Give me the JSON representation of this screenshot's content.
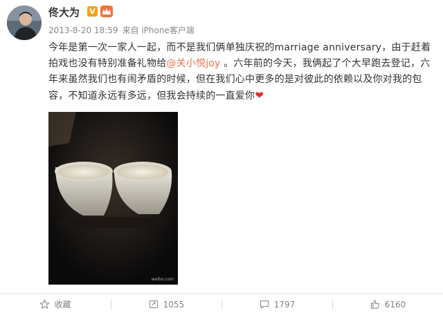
{
  "post": {
    "username": "佟大为",
    "verified_badge": "V",
    "timestamp": "2013-8-20 18:59",
    "source": "来自 iPhone客户端",
    "text_part1": "今年是第一次一家人一起，而不是我们俩单独庆祝的marriage anniversary，由于赶着拍戏也没有特别准备礼物给",
    "mention": "@关小悦joy",
    "text_part2": " 。六年前的今天，我俩起了个大早跑去登记，六年来虽然我们也有闹矛盾的时候，但在我们心中更多的是对彼此的依赖以及你对我的包容，不知道永远有多远，但我会持续的一直爱你",
    "emoji": "❤",
    "image_watermark": "weibo.com"
  },
  "actions": {
    "favorite_label": "收藏",
    "repost_count": "1055",
    "comment_count": "1797",
    "like_count": "6160"
  },
  "colors": {
    "mention": "#eb7350",
    "heart": "#e02b2b",
    "meta_text": "#888888",
    "vip_badge": "#f0733b",
    "verified_badge": "#f4a21b"
  },
  "icons": [
    "avatar",
    "verified-badge",
    "vip-badge",
    "star-icon",
    "repost-icon",
    "comment-icon",
    "like-icon",
    "heart-emoji"
  ]
}
